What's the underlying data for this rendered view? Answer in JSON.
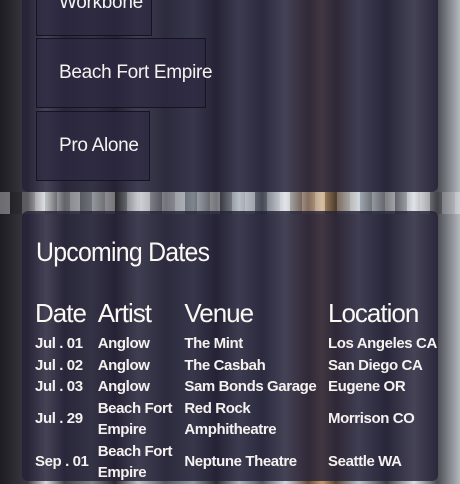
{
  "albums": [
    {
      "label": "Workbone"
    },
    {
      "label": "Beach Fort Empire"
    },
    {
      "label": "Pro Alone"
    }
  ],
  "dates_section": {
    "title": "Upcoming Dates",
    "columns": {
      "date": "Date",
      "artist": "Artist",
      "venue": "Venue",
      "location": "Location"
    },
    "rows": [
      {
        "date": "Jul . 01",
        "artist": [
          "Anglow"
        ],
        "venue": [
          "The Mint"
        ],
        "location": "Los Angeles CA"
      },
      {
        "date": "Jul . 02",
        "artist": [
          "Anglow"
        ],
        "venue": [
          "The Casbah"
        ],
        "location": "San Diego CA"
      },
      {
        "date": "Jul . 03",
        "artist": [
          "Anglow"
        ],
        "venue": [
          "Sam Bonds Garage"
        ],
        "location": "Eugene OR"
      },
      {
        "date": "Jul . 29",
        "artist": [
          "Beach Fort",
          "Empire"
        ],
        "venue": [
          "Red Rock",
          "Amphitheatre"
        ],
        "location": "Morrison CO"
      },
      {
        "date": "Sep . 01",
        "artist": [
          "Beach Fort",
          "Empire"
        ],
        "venue": [
          "Neptune Theatre"
        ],
        "location": "Seattle WA"
      }
    ]
  }
}
